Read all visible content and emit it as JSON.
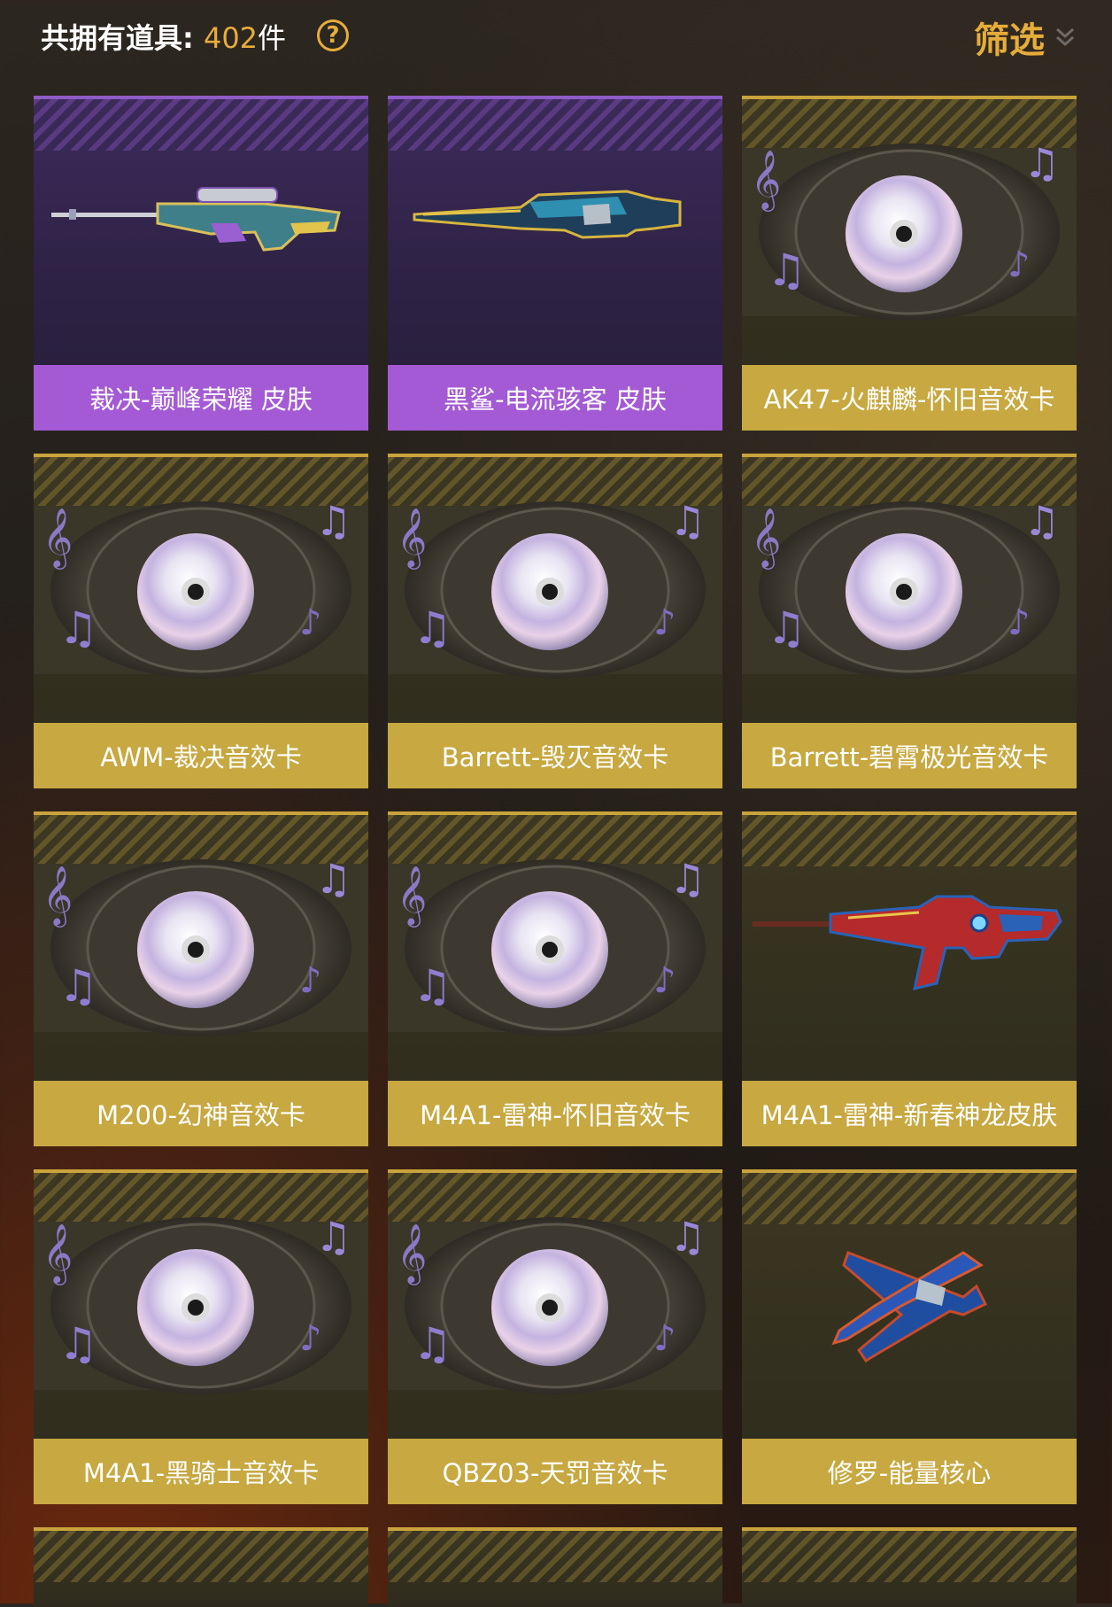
{
  "header": {
    "count_label": "共拥有道具:",
    "count_value": "402",
    "count_unit": "件",
    "help_icon": "?",
    "filter_label": "筛选"
  },
  "items": [
    {
      "label": "裁决-巅峰荣耀 皮肤",
      "rarity": "purple",
      "icon": "sniper-rifle-skin"
    },
    {
      "label": "黑鲨-电流骇客 皮肤",
      "rarity": "purple",
      "icon": "rifle-skin"
    },
    {
      "label": "AK47-火麒麟-怀旧音效卡",
      "rarity": "gold",
      "icon": "sound-card-disc"
    },
    {
      "label": "AWM-裁决音效卡",
      "rarity": "gold",
      "icon": "sound-card-disc"
    },
    {
      "label": "Barrett-毁灭音效卡",
      "rarity": "gold",
      "icon": "sound-card-disc"
    },
    {
      "label": "Barrett-碧霄极光音效卡",
      "rarity": "gold",
      "icon": "sound-card-disc"
    },
    {
      "label": "M200-幻神音效卡",
      "rarity": "gold",
      "icon": "sound-card-disc"
    },
    {
      "label": "M4A1-雷神-怀旧音效卡",
      "rarity": "gold",
      "icon": "sound-card-disc"
    },
    {
      "label": "M4A1-雷神-新春神龙皮肤",
      "rarity": "gold",
      "icon": "assault-rifle-skin"
    },
    {
      "label": "M4A1-黑骑士音效卡",
      "rarity": "gold",
      "icon": "sound-card-disc"
    },
    {
      "label": "QBZ03-天罚音效卡",
      "rarity": "gold",
      "icon": "sound-card-disc"
    },
    {
      "label": "修罗-能量核心",
      "rarity": "gold",
      "icon": "pistol-knife-core"
    }
  ],
  "colors": {
    "gold": "#c7a841",
    "purple": "#a45ad4",
    "accent": "#e6ad3a"
  }
}
